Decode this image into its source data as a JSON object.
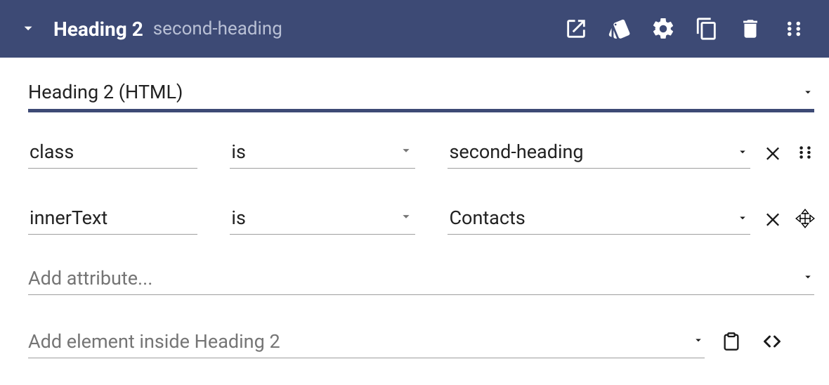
{
  "header": {
    "title": "Heading 2",
    "subtitle": "second-heading"
  },
  "element_type": {
    "label": "Heading 2 (HTML)"
  },
  "attributes": [
    {
      "attr": "class",
      "op": "is",
      "value": "second-heading"
    },
    {
      "attr": "innerText",
      "op": "is",
      "value": "Contacts"
    }
  ],
  "add_attribute_placeholder": "Add attribute...",
  "add_inside_placeholder": "Add element inside Heading 2"
}
